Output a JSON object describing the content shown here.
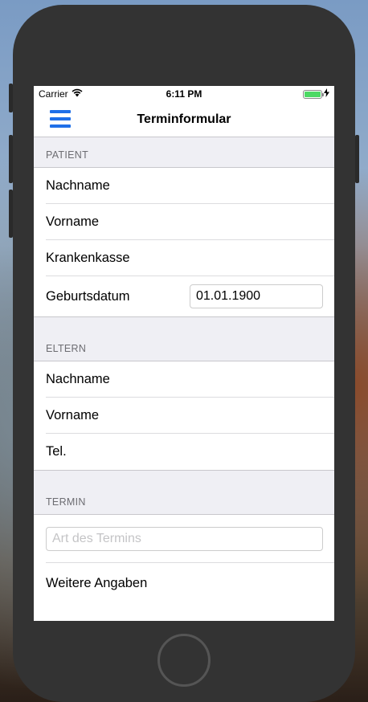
{
  "status_bar": {
    "carrier": "Carrier",
    "time": "6:11 PM"
  },
  "nav": {
    "title": "Terminformular"
  },
  "patient": {
    "header": "PATIENT",
    "lastname_label": "Nachname",
    "firstname_label": "Vorname",
    "insurance_label": "Krankenkasse",
    "birthdate_label": "Geburtsdatum",
    "birthdate_value": "01.01.1900"
  },
  "parents": {
    "header": "ELTERN",
    "lastname_label": "Nachname",
    "firstname_label": "Vorname",
    "phone_label": "Tel."
  },
  "appointment": {
    "header": "TERMIN",
    "type_placeholder": "Art des Termins",
    "more_info_label": "Weitere Angaben"
  },
  "colors": {
    "accent": "#1f6fe8",
    "section_bg": "#efeff4",
    "phone_frame": "#333333"
  }
}
